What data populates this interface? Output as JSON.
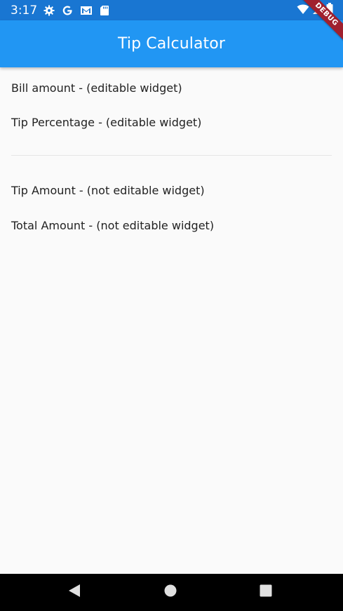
{
  "status_bar": {
    "time": "3:17",
    "left_icons": [
      "gear-icon",
      "google-icon",
      "gmail-icon",
      "sd-card-icon"
    ],
    "right_icons": [
      "wifi-icon",
      "signal-icon",
      "battery-icon"
    ],
    "color": "#1976d2"
  },
  "app_bar": {
    "title": "Tip Calculator",
    "color": "#2196f3"
  },
  "debug_banner": {
    "label": "DEBUG",
    "color": "#a0202e"
  },
  "form": {
    "bill_amount_label": "Bill amount - (editable widget)",
    "tip_percentage_label": "Tip Percentage - (editable widget)",
    "tip_amount_label": "Tip Amount - (not editable widget)",
    "total_amount_label": "Total Amount - (not editable widget)"
  },
  "nav_bar": {
    "buttons": [
      "back-icon",
      "home-icon",
      "recent-apps-icon"
    ]
  }
}
